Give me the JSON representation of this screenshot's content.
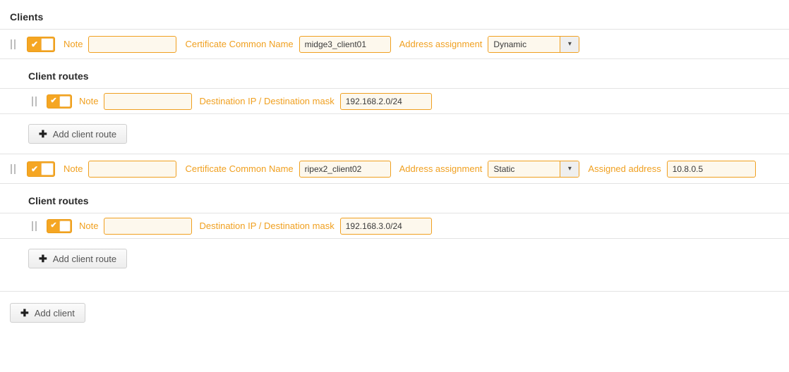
{
  "section": {
    "title": "Clients",
    "add_client_button": "Add client",
    "plus_glyph": "✚",
    "check_glyph": "✔",
    "chevron_glyph": "▾"
  },
  "labels": {
    "note": "Note",
    "certificate_common_name": "Certificate Common Name",
    "address_assignment": "Address assignment",
    "assigned_address": "Assigned address",
    "destination": "Destination IP / Destination mask",
    "client_routes": "Client routes",
    "add_client_route": "Add client route"
  },
  "colors": {
    "accent": "#f0a020",
    "toggle_on": "#f5a623",
    "field_bg": "#fdf8ed",
    "row_border": "#e3e3e3",
    "heading": "#2b2b2b"
  },
  "clients": [
    {
      "enabled": true,
      "note": "",
      "note_placeholder": "",
      "certificate_common_name": "midge3_client01",
      "address_assignment": "Dynamic",
      "address_assignment_options": [
        "Dynamic",
        "Static"
      ],
      "assigned_address": null,
      "has_assigned_address": false,
      "routes_title": "Client routes",
      "routes": [
        {
          "enabled": true,
          "note": "",
          "destination": "192.168.2.0/24"
        }
      ],
      "add_route_label": "Add client route"
    },
    {
      "enabled": true,
      "note": "",
      "note_placeholder": "",
      "certificate_common_name": "ripex2_client02",
      "address_assignment": "Static",
      "address_assignment_options": [
        "Dynamic",
        "Static"
      ],
      "assigned_address": "10.8.0.5",
      "has_assigned_address": true,
      "routes_title": "Client routes",
      "routes": [
        {
          "enabled": true,
          "note": "",
          "destination": "192.168.3.0/24"
        }
      ],
      "add_route_label": "Add client route"
    }
  ]
}
